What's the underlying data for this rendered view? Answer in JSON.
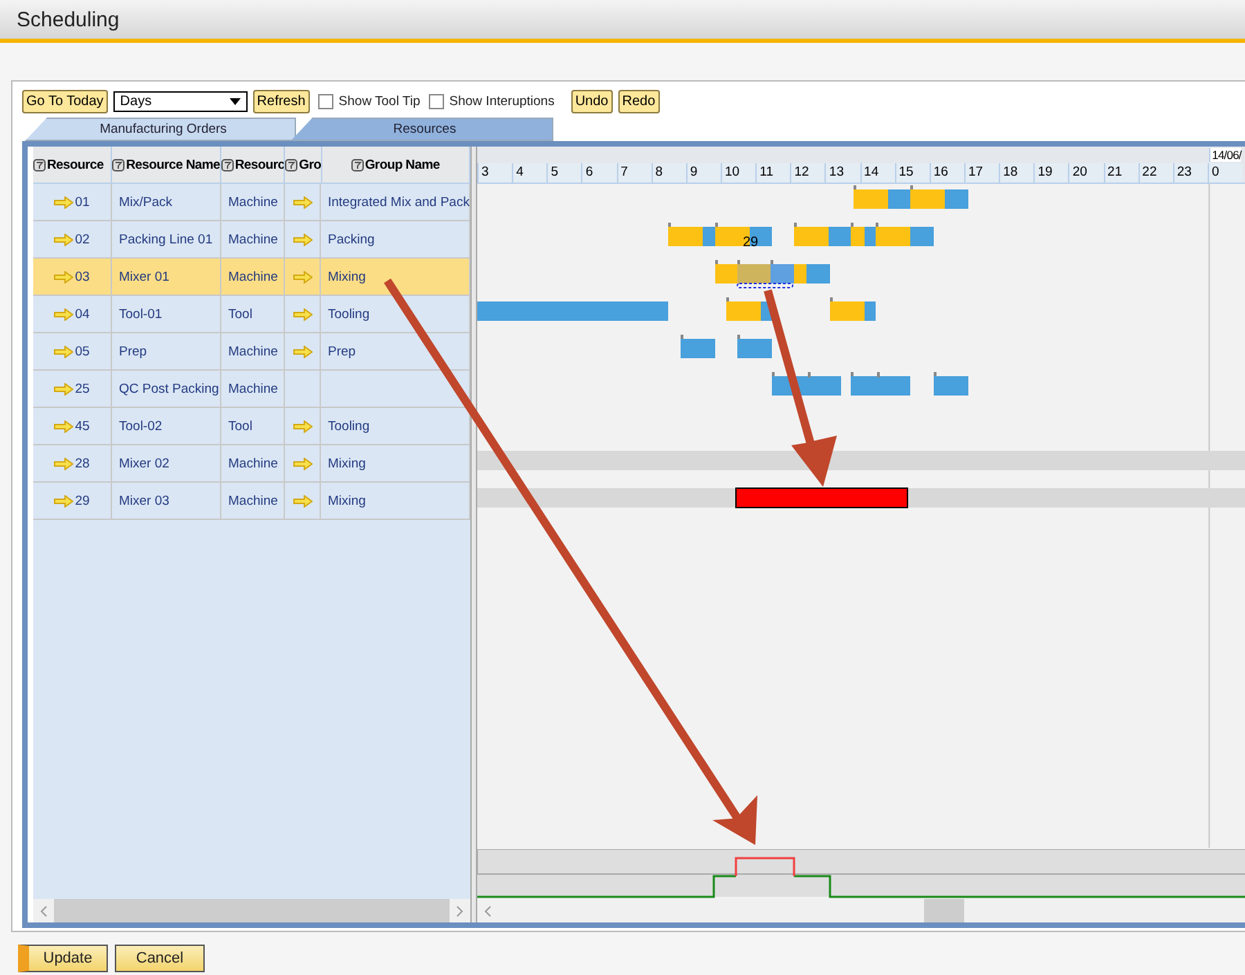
{
  "window": {
    "title": "Scheduling"
  },
  "toolbar": {
    "today_button": "Go To Today",
    "view_select": "Days",
    "refresh_button": "Refresh",
    "checkboxes": [
      {
        "label": "Show Tool Tip",
        "checked": false
      },
      {
        "label": "Show Interuptions",
        "checked": false
      }
    ],
    "undo_button": "Undo",
    "redo_button": "Redo"
  },
  "tabs": [
    {
      "label": "Manufacturing Orders",
      "selected": false
    },
    {
      "label": "Resources",
      "selected": true
    }
  ],
  "table": {
    "columns": [
      "Resource",
      "Resource Name",
      "Resourc",
      "Gro",
      "Group Name"
    ],
    "rows": [
      {
        "code": "01",
        "name": "Mix/Pack",
        "type": "Machine",
        "group_link": true,
        "group": "Integrated Mix and Pack",
        "selected": false
      },
      {
        "code": "02",
        "name": "Packing Line 01",
        "type": "Machine",
        "group_link": true,
        "group": "Packing",
        "selected": false
      },
      {
        "code": "03",
        "name": "Mixer 01",
        "type": "Machine",
        "group_link": true,
        "group": "Mixing",
        "selected": true
      },
      {
        "code": "04",
        "name": "Tool-01",
        "type": "Tool",
        "group_link": true,
        "group": "Tooling",
        "selected": false
      },
      {
        "code": "05",
        "name": "Prep",
        "type": "Machine",
        "group_link": true,
        "group": "Prep",
        "selected": false
      },
      {
        "code": "25",
        "name": "QC Post Packing",
        "type": "Machine",
        "group_link": false,
        "group": "",
        "selected": false
      },
      {
        "code": "45",
        "name": "Tool-02",
        "type": "Tool",
        "group_link": true,
        "group": "Tooling",
        "selected": false
      },
      {
        "code": "28",
        "name": "Mixer 02",
        "type": "Machine",
        "group_link": true,
        "group": "Mixing",
        "selected": false
      },
      {
        "code": "29",
        "name": "Mixer 03",
        "type": "Machine",
        "group_link": true,
        "group": "Mixing",
        "selected": false
      }
    ]
  },
  "timeline": {
    "date": "14/06/",
    "hours": [
      "3",
      "4",
      "5",
      "6",
      "7",
      "8",
      "9",
      "10",
      "11",
      "12",
      "13",
      "14",
      "15",
      "16",
      "17",
      "18",
      "19",
      "20",
      "21",
      "22",
      "23",
      "0"
    ],
    "drag_label": "29"
  },
  "footer_buttons": [
    "Update",
    "Cancel"
  ]
}
